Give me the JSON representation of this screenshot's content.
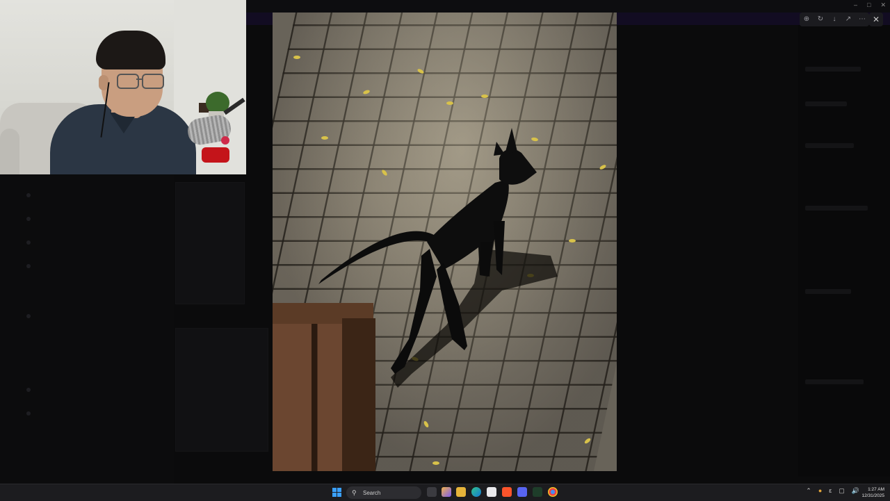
{
  "viewer": {
    "toolbar_icons": [
      "zoom-in-icon",
      "rotate-icon",
      "download-icon",
      "open-external-icon",
      "more-icon"
    ],
    "close_icon": "close-icon"
  },
  "window_controls": [
    "minimize-icon",
    "maximize-icon",
    "close-icon"
  ],
  "taskbar": {
    "search_placeholder": "Search",
    "pinned_icons": [
      "task-view-icon",
      "copilot-icon",
      "file-explorer-icon",
      "edge-icon",
      "store-icon",
      "brave-icon",
      "discord-icon",
      "excel-icon",
      "chrome-icon"
    ],
    "tray_icons": [
      "chevron-up-icon",
      "mic-icon",
      "language-icon",
      "network-icon",
      "volume-icon"
    ],
    "clock": {
      "time": "1:27 AM",
      "date": "12/31/2025"
    }
  },
  "colors": {
    "taskbar_bg": "#1c1c1f",
    "start_blue": "#3aa0ff",
    "viewer_bg": "#000000"
  }
}
